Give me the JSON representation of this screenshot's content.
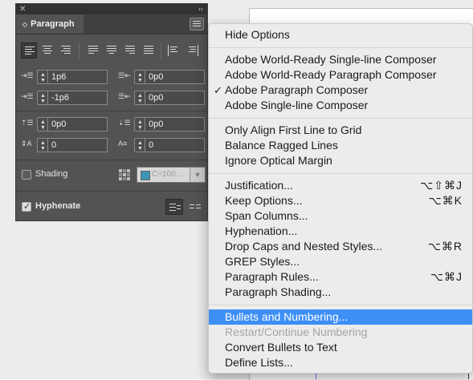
{
  "panel": {
    "title": "Paragraph",
    "fields": {
      "left_indent": "1p6",
      "right_indent": "0p0",
      "first_line_indent": "-1p6",
      "last_line_indent": "0p0",
      "space_before": "0p0",
      "space_after": "0p0",
      "drop_cap_lines": "0",
      "drop_cap_chars": "0"
    },
    "shading_label": "Shading",
    "shading_checked": false,
    "shading_color_text": "C=100...",
    "shading_color": "#3b95b8",
    "hyphenate_label": "Hyphenate",
    "hyphenate_checked": true
  },
  "menu": {
    "items": [
      {
        "label": "Hide Options",
        "shortcut": "",
        "checked": false,
        "disabled": false,
        "highlighted": false
      },
      {
        "label": "Adobe World-Ready Single-line Composer",
        "shortcut": "",
        "checked": false,
        "disabled": false,
        "highlighted": false
      },
      {
        "label": "Adobe World-Ready Paragraph Composer",
        "shortcut": "",
        "checked": false,
        "disabled": false,
        "highlighted": false
      },
      {
        "label": "Adobe Paragraph Composer",
        "shortcut": "",
        "checked": true,
        "disabled": false,
        "highlighted": false
      },
      {
        "label": "Adobe Single-line Composer",
        "shortcut": "",
        "checked": false,
        "disabled": false,
        "highlighted": false
      },
      {
        "label": "Only Align First Line to Grid",
        "shortcut": "",
        "checked": false,
        "disabled": false,
        "highlighted": false
      },
      {
        "label": "Balance Ragged Lines",
        "shortcut": "",
        "checked": false,
        "disabled": false,
        "highlighted": false
      },
      {
        "label": "Ignore Optical Margin",
        "shortcut": "",
        "checked": false,
        "disabled": false,
        "highlighted": false
      },
      {
        "label": "Justification...",
        "shortcut": "⌥⇧⌘J",
        "checked": false,
        "disabled": false,
        "highlighted": false
      },
      {
        "label": "Keep Options...",
        "shortcut": "⌥⌘K",
        "checked": false,
        "disabled": false,
        "highlighted": false
      },
      {
        "label": "Span Columns...",
        "shortcut": "",
        "checked": false,
        "disabled": false,
        "highlighted": false
      },
      {
        "label": "Hyphenation...",
        "shortcut": "",
        "checked": false,
        "disabled": false,
        "highlighted": false
      },
      {
        "label": "Drop Caps and Nested Styles...",
        "shortcut": "⌥⌘R",
        "checked": false,
        "disabled": false,
        "highlighted": false
      },
      {
        "label": "GREP Styles...",
        "shortcut": "",
        "checked": false,
        "disabled": false,
        "highlighted": false
      },
      {
        "label": "Paragraph Rules...",
        "shortcut": "⌥⌘J",
        "checked": false,
        "disabled": false,
        "highlighted": false
      },
      {
        "label": "Paragraph Shading...",
        "shortcut": "",
        "checked": false,
        "disabled": false,
        "highlighted": false
      },
      {
        "label": "Bullets and Numbering...",
        "shortcut": "",
        "checked": false,
        "disabled": false,
        "highlighted": true
      },
      {
        "label": "Restart/Continue Numbering",
        "shortcut": "",
        "checked": false,
        "disabled": true,
        "highlighted": false
      },
      {
        "label": "Convert Bullets to Text",
        "shortcut": "",
        "checked": false,
        "disabled": false,
        "highlighted": false
      },
      {
        "label": "Define Lists...",
        "shortcut": "",
        "checked": false,
        "disabled": false,
        "highlighted": false
      }
    ],
    "highlight_color": "#3d8ff6"
  }
}
